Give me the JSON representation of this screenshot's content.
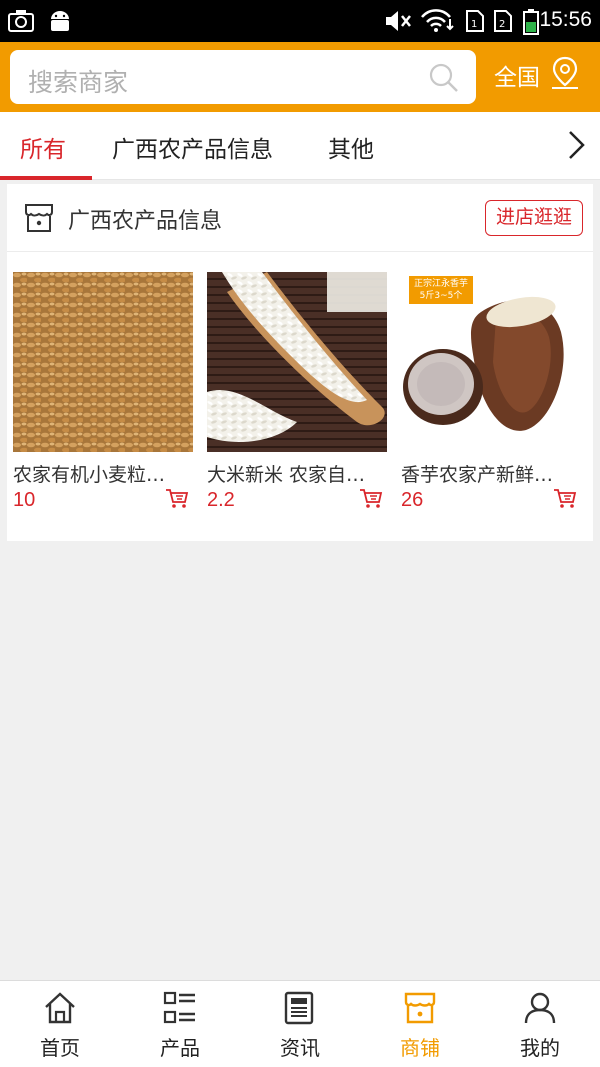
{
  "status_bar": {
    "time": "15:56"
  },
  "search": {
    "placeholder": "搜索商家",
    "region": "全国"
  },
  "tabs": [
    {
      "label": "所有",
      "active": true
    },
    {
      "label": "广西农产品信息",
      "active": false
    },
    {
      "label": "其他",
      "active": false
    }
  ],
  "shop": {
    "name": "广西农产品信息",
    "visit_label": "进店逛逛",
    "products": [
      {
        "name": "农家有机小麦粒…",
        "price": "10",
        "image": "wheat-grains"
      },
      {
        "name": "大米新米 农家自…",
        "price": "2.2",
        "image": "rice-scoop"
      },
      {
        "name": "香芋农家产新鲜…",
        "price": "26",
        "image": "taro",
        "badge_line1": "正宗江永香芋",
        "badge_line2": "5斤3~5个"
      }
    ]
  },
  "bottom_nav": [
    {
      "label": "首页",
      "icon": "home-icon",
      "active": false
    },
    {
      "label": "产品",
      "icon": "list-icon",
      "active": false
    },
    {
      "label": "资讯",
      "icon": "news-icon",
      "active": false
    },
    {
      "label": "商铺",
      "icon": "shop-icon",
      "active": true
    },
    {
      "label": "我的",
      "icon": "user-icon",
      "active": false
    }
  ],
  "colors": {
    "accent": "#f29b00",
    "red": "#d9262b"
  }
}
